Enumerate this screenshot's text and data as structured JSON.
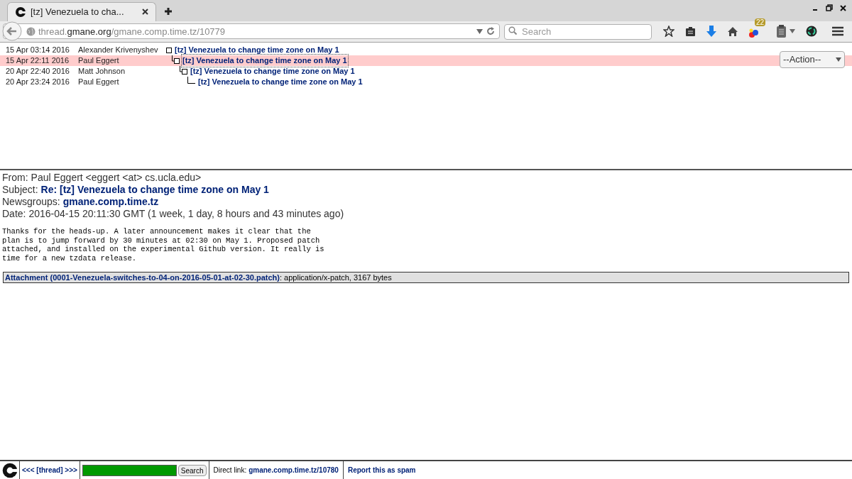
{
  "browser": {
    "tab_title": "[tz] Venezuela to cha...",
    "url_host_prefix": "thread.",
    "url_host": "gmane.org",
    "url_path": "/gmane.comp.time.tz/10779",
    "search_placeholder": "Search",
    "badge": "22"
  },
  "thread": [
    {
      "date": "15 Apr 03:14 2016",
      "author": "Alexander Krivenyshev",
      "subject": "[tz] Venezuela to change time zone on May 1",
      "selected": false,
      "children": [
        {
          "date": "15 Apr 22:11 2016",
          "author": "Paul Eggert",
          "subject": "[tz] Venezuela to change time zone on May 1",
          "selected": true,
          "children": [
            {
              "date": "20 Apr 22:40 2016",
              "author": "Matt Johnson",
              "subject": "[tz] Venezuela to change time zone on May 1",
              "selected": false,
              "children": [
                {
                  "date": "20 Apr 23:24 2016",
                  "author": "Paul Eggert",
                  "subject": "[tz] Venezuela to change time zone on May 1",
                  "selected": false
                }
              ]
            }
          ]
        }
      ]
    }
  ],
  "action_select": "--Action--",
  "message": {
    "from_label": "From:",
    "from": "Paul Eggert <eggert <at> cs.ucla.edu>",
    "subject_label": "Subject:",
    "subject": "Re: [tz] Venezuela to change time zone on May 1",
    "newsgroups_label": "Newsgroups:",
    "newsgroups": "gmane.comp.time.tz",
    "date_label": "Date:",
    "date": "2016-04-15 20:11:30 GMT (1 week, 1 day, 8 hours and 43 minutes ago)",
    "body": "Thanks for the heads-up. A later announcement makes it clear that the\nplan is to jump forward by 30 minutes at 02:30 on May 1. Proposed patch\nattached, and installed on the experimental Github version. It really is\ntime for a new tzdata release.",
    "attachment_link": "Attachment (0001-Venezuela-switches-to-04-on-2016-05-01-at-02-30.patch)",
    "attachment_info": ": application/x-patch, 3167 bytes"
  },
  "footer": {
    "thread_nav": "<<< [thread] >>>",
    "search_button": "Search",
    "direct_label": "Direct link:",
    "direct_link": "gmane.comp.time.tz/10780",
    "spam_link": "Report this as spam"
  }
}
